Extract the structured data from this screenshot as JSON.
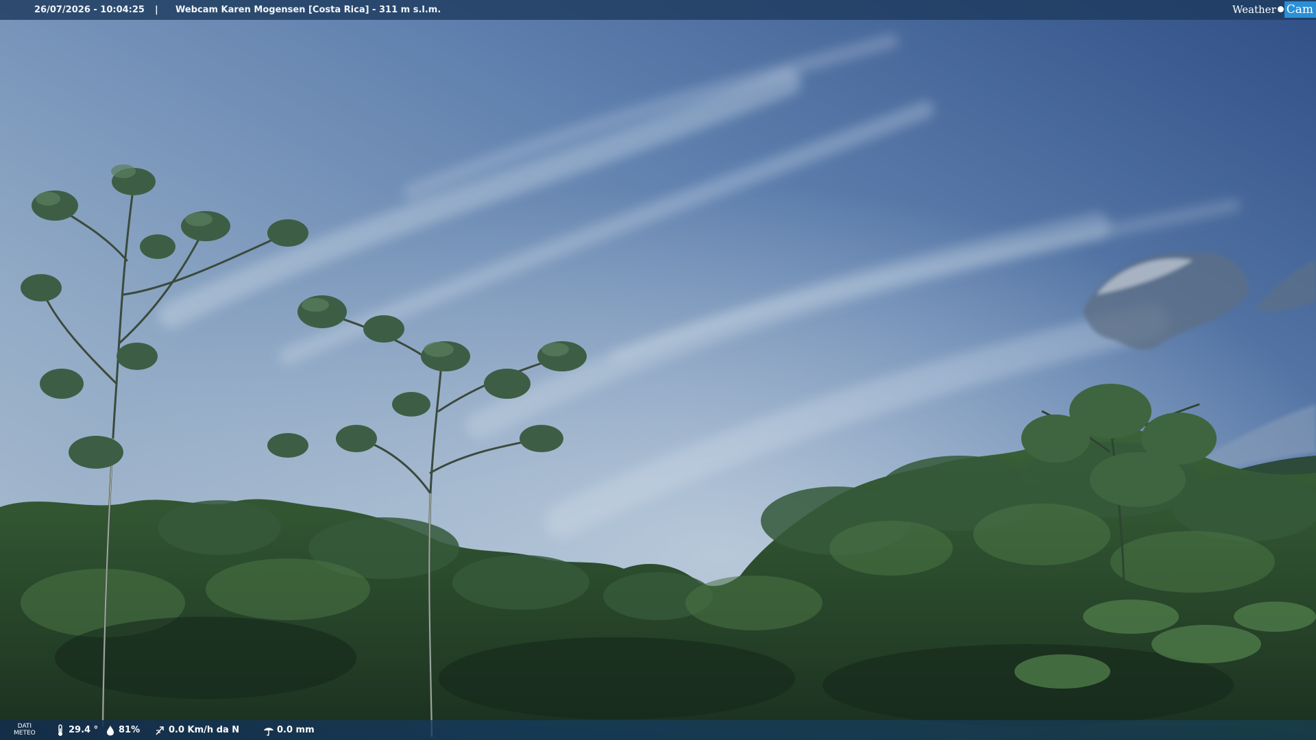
{
  "header": {
    "datetime": "26/07/2026 - 10:04:25",
    "separator": "|",
    "title": "Webcam Karen Mogensen [Costa Rica]  - 311 m s.l.m."
  },
  "logo": {
    "weather": "Weather",
    "cam": "Cam"
  },
  "footer": {
    "label_line1": "DATI",
    "label_line2": "METEO",
    "temperature": "29.4 °",
    "humidity": "81%",
    "wind": "0.0 Km/h da N",
    "rain": "0.0 mm"
  },
  "icons": {
    "temperature": "thermometer-icon",
    "humidity": "humidity-drop-icon",
    "wind": "wind-icon",
    "rain": "rain-icon"
  },
  "colors": {
    "sky_top": "#3f6296",
    "sky_mid": "#8aa6c6",
    "foliage_dark": "#1d3322",
    "foliage_light": "#3e6a3c",
    "bar": "#1e3c5f",
    "logo_accent": "#2b8fd6"
  }
}
